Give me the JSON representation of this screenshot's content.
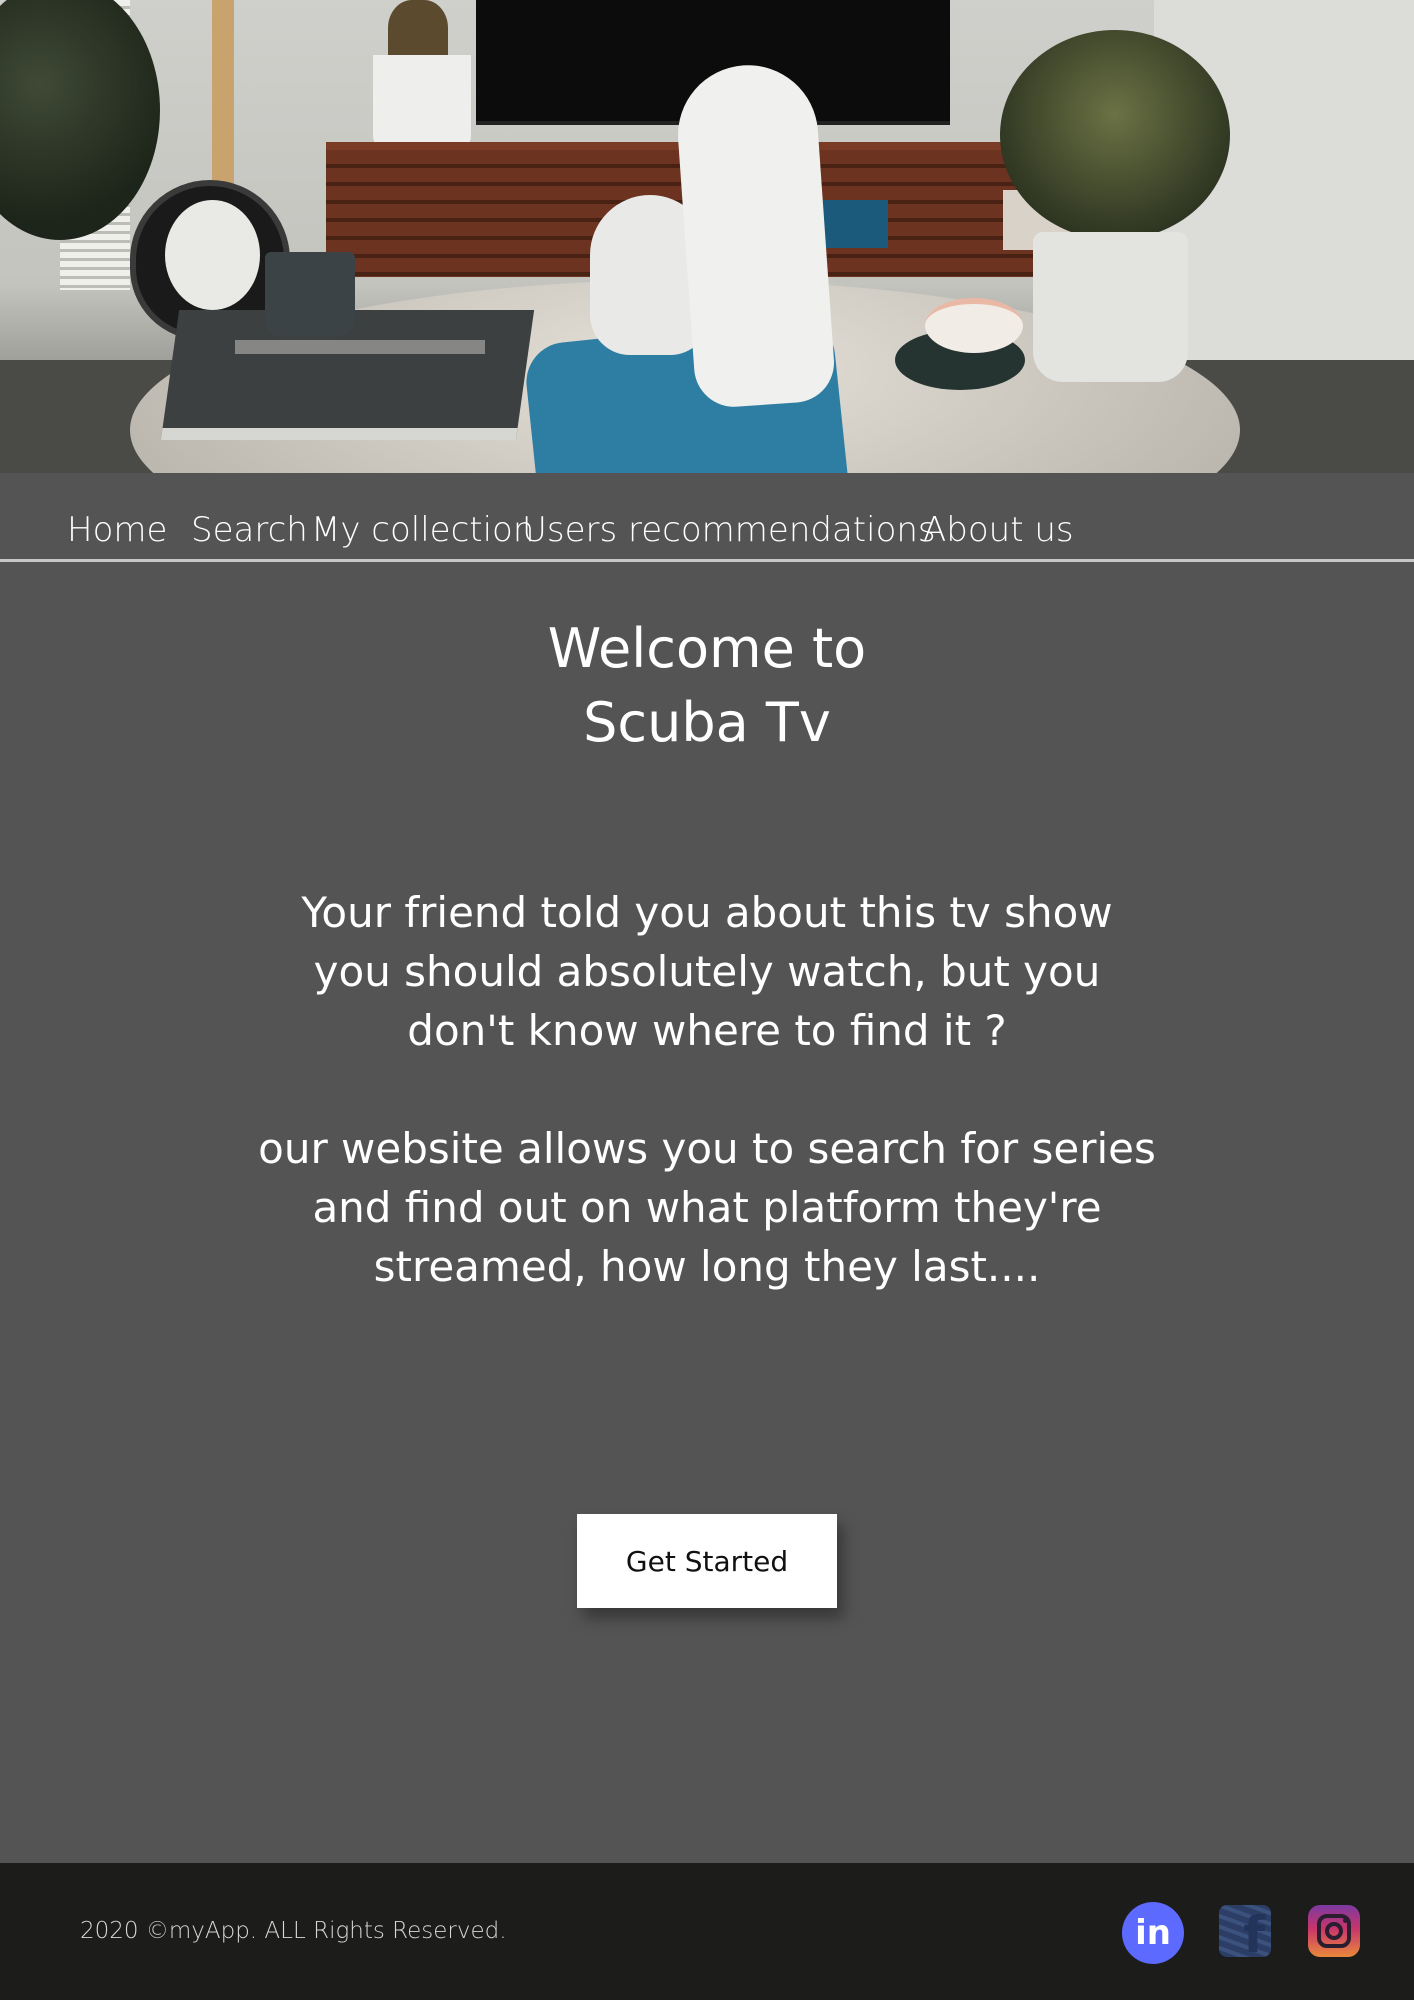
{
  "nav": {
    "items": [
      {
        "label": "Home"
      },
      {
        "label": "Search"
      },
      {
        "label": "My collection"
      },
      {
        "label": "Users recommendations"
      },
      {
        "label": "About us"
      }
    ]
  },
  "hero": {
    "title_line1": "Welcome to",
    "title_line2": "Scuba Tv",
    "paragraph1": "Your friend told you about this tv show you should absolutely watch, but you don't know where to find it ?",
    "paragraph2": "our website allows you to search for series and find out on what platform they're streamed, how long they last....",
    "cta_label": "Get Started",
    "image_icon": "living-room-photo"
  },
  "footer": {
    "copyright": "2020 ©myApp. ALL Rights Reserved.",
    "social": [
      {
        "icon": "linkedin-icon",
        "color": "#5d6aff"
      },
      {
        "icon": "facebook-icon",
        "color": "#3b527e"
      },
      {
        "icon": "instagram-icon",
        "color": "#c8356b"
      }
    ]
  },
  "colors": {
    "page_background": "#545454",
    "footer_background": "#1c1d1b",
    "text": "#ffffff",
    "button_background": "#ffffff"
  }
}
